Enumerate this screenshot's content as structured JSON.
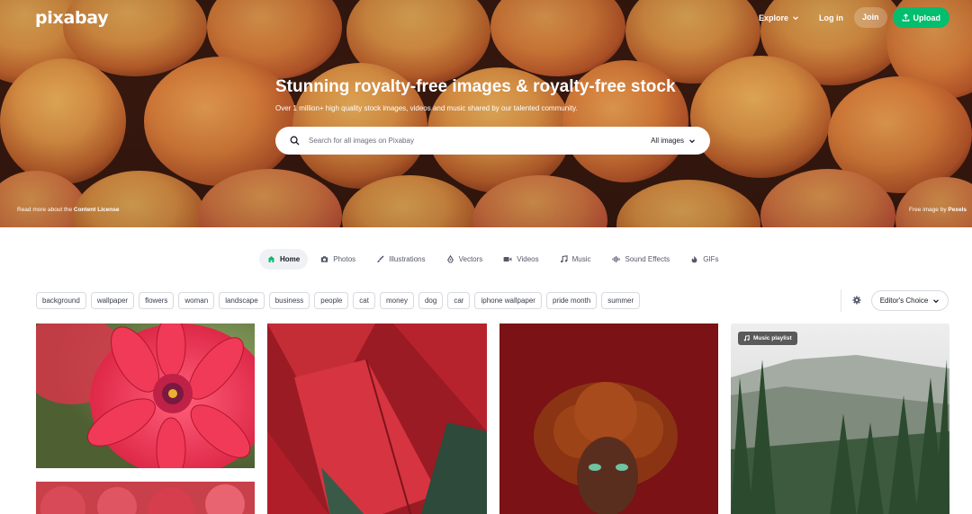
{
  "brand": {
    "logo": "pixabay"
  },
  "topnav": {
    "explore": "Explore",
    "login": "Log in",
    "join": "Join",
    "upload": "Upload"
  },
  "hero": {
    "title": "Stunning royalty-free images & royalty-free stock",
    "subtitle": "Over 1 million+ high quality stock images, videos and music shared by our talented community.",
    "search_placeholder": "Search for all images on Pixabay",
    "search_filter": "All images",
    "license_prefix": "Read more about the ",
    "license_link": "Content License",
    "credit_prefix": "Free image by ",
    "credit_author": "Pexels"
  },
  "tabs": [
    {
      "label": "Home",
      "icon": "home-icon",
      "active": true
    },
    {
      "label": "Photos",
      "icon": "camera-icon"
    },
    {
      "label": "Illustrations",
      "icon": "brush-icon"
    },
    {
      "label": "Vectors",
      "icon": "vector-pen-icon"
    },
    {
      "label": "Videos",
      "icon": "video-camera-icon"
    },
    {
      "label": "Music",
      "icon": "music-note-icon"
    },
    {
      "label": "Sound Effects",
      "icon": "waveform-icon"
    },
    {
      "label": "GIFs",
      "icon": "flame-icon"
    }
  ],
  "tags": [
    "background",
    "wallpaper",
    "flowers",
    "woman",
    "landscape",
    "business",
    "people",
    "cat",
    "money",
    "dog",
    "car",
    "iphone wallpaper",
    "pride month",
    "summer"
  ],
  "sort": {
    "label": "Editor's Choice"
  },
  "grid": {
    "badge_music": "Music playlist"
  },
  "colors": {
    "accent": "#02be6e",
    "text": "#191b26"
  }
}
